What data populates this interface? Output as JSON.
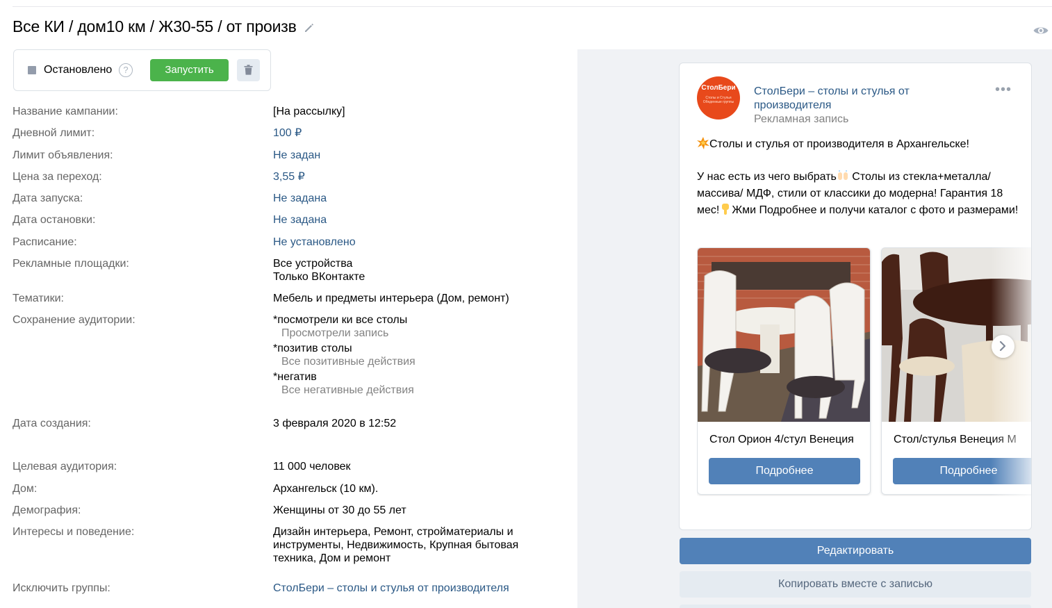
{
  "page": {
    "title": "Все КИ / дом10 км / Ж30-55 / от произв"
  },
  "status": {
    "text": "Остановлено",
    "help_glyph": "?",
    "start_label": "Запустить"
  },
  "details": [
    {
      "label": "Название кампании:",
      "lines": [
        "[На рассылку]"
      ],
      "link": false
    },
    {
      "label": "Дневной лимит:",
      "lines": [
        "100 ₽"
      ],
      "link": true
    },
    {
      "label": "Лимит объявления:",
      "lines": [
        "Не задан"
      ],
      "link": true
    },
    {
      "label": "Цена за переход:",
      "lines": [
        "3,55 ₽"
      ],
      "link": true
    },
    {
      "label": "Дата запуска:",
      "lines": [
        "Не задана"
      ],
      "link": true
    },
    {
      "label": "Дата остановки:",
      "lines": [
        "Не задана"
      ],
      "link": true
    },
    {
      "label": "Расписание:",
      "lines": [
        "Не установлено"
      ],
      "link": true
    },
    {
      "label": "Рекламные площадки:",
      "lines": [
        "Все устройства",
        "Только ВКонтакте"
      ],
      "link": false
    },
    {
      "label": "Тематики:",
      "lines": [
        "Мебель и предметы интерьера (Дом, ремонт)"
      ],
      "link": false
    },
    {
      "label": "Сохранение аудитории:",
      "retarget": [
        {
          "name": "*посмотрели ки все столы",
          "sub": "Просмотрели запись"
        },
        {
          "name": "*позитив столы",
          "sub": "Все позитивные действия"
        },
        {
          "name": "*негатив",
          "sub": "Все негативные действия"
        }
      ]
    },
    {
      "label": "Дата создания:",
      "lines": [
        "3 февраля 2020 в 12:52"
      ],
      "link": false
    },
    {
      "label": "Целевая аудитория:",
      "lines": [
        "11 000 человек"
      ],
      "link": false
    },
    {
      "label": "Дом:",
      "lines": [
        "Архангельск (10 км)."
      ],
      "link": false
    },
    {
      "label": "Демография:",
      "lines": [
        "Женщины от 30 до 55 лет"
      ],
      "link": false
    },
    {
      "label": "Интересы и поведение:",
      "lines": [
        "Дизайн интерьера, Ремонт, стройматериалы и",
        "инструменты, Недвижимость, Крупная бытовая",
        "техника, Дом и ремонт"
      ],
      "link": false
    },
    {
      "label": "Исключить группы:",
      "lines": [
        "СтолБери – столы и стулья от производителя"
      ],
      "link": true
    }
  ],
  "post": {
    "avatar_text": "СтолБери",
    "avatar_sub": "Столы и Стулья Обеденные группы",
    "group_name": "СтолБери – столы и стулья от производителя",
    "post_type": "Рекламная запись",
    "text_line1": "Столы и стулья от производителя в Архангельске!",
    "text_p2_a": "У нас есть из чего выбрать",
    "text_p2_b": " Столы из стекла+металла/ массива/ МДФ, стили от классики до модерна! Гарантия 18 мес!",
    "text_p2_c": "Жми Подробнее и получи каталог с фото и размерами!",
    "cards": [
      {
        "title": "Стол Орион 4/стул Венеция",
        "button": "Подробнее"
      },
      {
        "title": "Стол/стулья Венеция М",
        "button": "Подробнее"
      }
    ]
  },
  "actions": {
    "edit_label": "Редактировать",
    "copy_label": "Копировать вместе с записью"
  },
  "colors": {
    "link": "#2a5885",
    "label": "#656565",
    "start_green": "#4bb34b",
    "vk_blue": "#5181b8",
    "avatar_orange": "#e8491b"
  }
}
